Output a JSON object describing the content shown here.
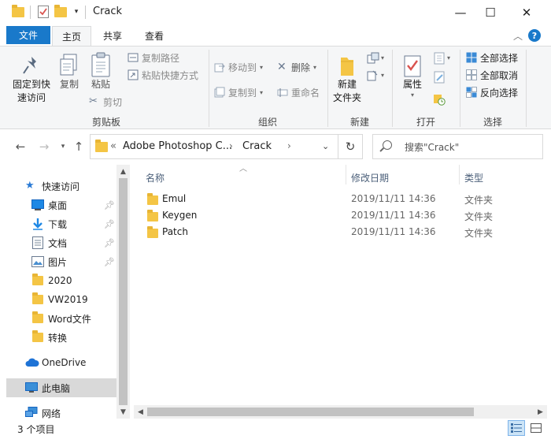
{
  "window": {
    "title": "Crack",
    "minimize_glyph": "—",
    "maximize_glyph": "☐",
    "close_glyph": "✕"
  },
  "tabs": {
    "file": "文件",
    "home": "主页",
    "share": "共享",
    "view": "查看",
    "active": "主页"
  },
  "ribbon": {
    "clipboard": {
      "group": "剪贴板",
      "pin_line1": "固定到快",
      "pin_line2": "速访问",
      "copy": "复制",
      "paste": "粘贴",
      "copy_path": "复制路径",
      "paste_shortcut": "粘贴快捷方式",
      "cut": "剪切"
    },
    "organize": {
      "group": "组织",
      "move_to": "移动到",
      "copy_to": "复制到",
      "delete": "删除",
      "rename": "重命名"
    },
    "new": {
      "group": "新建",
      "new_folder_line1": "新建",
      "new_folder_line2": "文件夹"
    },
    "open": {
      "group": "打开",
      "properties": "属性"
    },
    "select": {
      "group": "选择",
      "select_all": "全部选择",
      "select_none": "全部取消",
      "invert": "反向选择"
    }
  },
  "address": {
    "prefix": "«",
    "crumb1": "Adobe Photoshop C...",
    "crumb2": "Crack",
    "search_placeholder": "搜索\"Crack\""
  },
  "sidebar": {
    "quick_access": "快速访问",
    "items": [
      {
        "label": "桌面",
        "icon": "desktop-icon",
        "pinned": true
      },
      {
        "label": "下载",
        "icon": "download-icon",
        "pinned": true
      },
      {
        "label": "文档",
        "icon": "documents-icon",
        "pinned": true
      },
      {
        "label": "图片",
        "icon": "pictures-icon",
        "pinned": true
      },
      {
        "label": "2020",
        "icon": "folder-icon",
        "pinned": false
      },
      {
        "label": "VW2019",
        "icon": "folder-icon",
        "pinned": false
      },
      {
        "label": "Word文件",
        "icon": "folder-icon",
        "pinned": false
      },
      {
        "label": "转换",
        "icon": "folder-icon",
        "pinned": false
      }
    ],
    "onedrive": "OneDrive",
    "this_pc": "此电脑",
    "network": "网络"
  },
  "filelist": {
    "columns": {
      "name": "名称",
      "date": "修改日期",
      "type": "类型"
    },
    "rows": [
      {
        "name": "Emul",
        "date": "2019/11/11 14:36",
        "type": "文件夹"
      },
      {
        "name": "Keygen",
        "date": "2019/11/11 14:36",
        "type": "文件夹"
      },
      {
        "name": "Patch",
        "date": "2019/11/11 14:36",
        "type": "文件夹"
      }
    ]
  },
  "status": {
    "count": "3 个项目"
  },
  "colors": {
    "accent": "#1979ca",
    "folder": "#f4c545",
    "ribbon_bg": "#f5f6f7",
    "selected": "#d9d9d9"
  }
}
